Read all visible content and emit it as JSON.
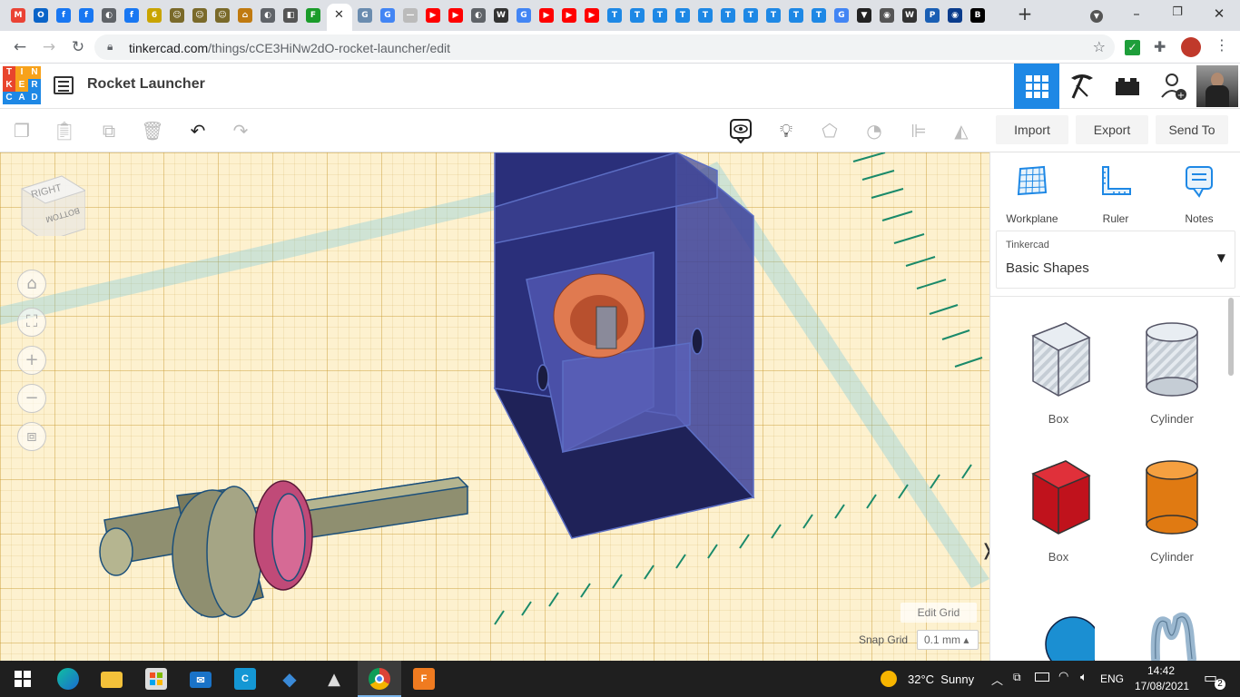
{
  "browser": {
    "tab_favicons": [
      {
        "icon": "gmail-icon",
        "color": "#ea4335",
        "glyph": "M"
      },
      {
        "icon": "outlook-icon",
        "color": "#0a64c8",
        "glyph": "O"
      },
      {
        "icon": "facebook-icon",
        "color": "#1877f2",
        "glyph": "f"
      },
      {
        "icon": "facebook-icon",
        "color": "#1877f2",
        "glyph": "f"
      },
      {
        "icon": "globe-icon",
        "color": "#5f6368",
        "glyph": "◐"
      },
      {
        "icon": "facebook-icon",
        "color": "#1877f2",
        "glyph": "f"
      },
      {
        "icon": "site-icon",
        "color": "#c9a400",
        "glyph": "6"
      },
      {
        "icon": "robot-icon",
        "color": "#7a6a2a",
        "glyph": "☺"
      },
      {
        "icon": "robot-icon",
        "color": "#7a6a2a",
        "glyph": "☺"
      },
      {
        "icon": "robot-icon",
        "color": "#7a6a2a",
        "glyph": "☺"
      },
      {
        "icon": "hat-icon",
        "color": "#c07a10",
        "glyph": "⌂"
      },
      {
        "icon": "globe-icon",
        "color": "#5f6368",
        "glyph": "◐"
      },
      {
        "icon": "shield-icon",
        "color": "#555",
        "glyph": "◧"
      },
      {
        "icon": "site-f-icon",
        "color": "#1a9c2a",
        "glyph": "F"
      }
    ],
    "more_tab_favicons": [
      {
        "icon": "docs-icon",
        "color": "#6a8caf",
        "glyph": "G"
      },
      {
        "icon": "google-icon",
        "color": "#4285f4",
        "glyph": "G"
      },
      {
        "icon": "bar-icon",
        "color": "#bbb",
        "glyph": "—"
      },
      {
        "icon": "youtube-icon",
        "color": "#ff0000",
        "glyph": "▶"
      },
      {
        "icon": "youtube-icon",
        "color": "#ff0000",
        "glyph": "▶"
      },
      {
        "icon": "globe-icon",
        "color": "#5f6368",
        "glyph": "◐"
      },
      {
        "icon": "wikipedia-icon",
        "color": "#333",
        "glyph": "W"
      },
      {
        "icon": "google-icon",
        "color": "#4285f4",
        "glyph": "G"
      },
      {
        "icon": "youtube-icon",
        "color": "#ff0000",
        "glyph": "▶"
      },
      {
        "icon": "youtube-icon",
        "color": "#ff0000",
        "glyph": "▶"
      },
      {
        "icon": "youtube-icon",
        "color": "#ff0000",
        "glyph": "▶"
      },
      {
        "icon": "tinkercad-t-icon",
        "color": "#1e88e5",
        "glyph": "T"
      },
      {
        "icon": "tinkercad-t-icon",
        "color": "#1e88e5",
        "glyph": "T"
      },
      {
        "icon": "tinkercad-t-icon",
        "color": "#1e88e5",
        "glyph": "T"
      },
      {
        "icon": "tinkercad-t-icon",
        "color": "#1e88e5",
        "glyph": "T"
      },
      {
        "icon": "tinkercad-t-icon",
        "color": "#1e88e5",
        "glyph": "T"
      },
      {
        "icon": "tinkercad-t-icon",
        "color": "#1e88e5",
        "glyph": "T"
      },
      {
        "icon": "tinkercad-t-icon",
        "color": "#1e88e5",
        "glyph": "T"
      },
      {
        "icon": "tinkercad-t-icon",
        "color": "#1e88e5",
        "glyph": "T"
      },
      {
        "icon": "tinkercad-t-icon",
        "color": "#1e88e5",
        "glyph": "T"
      },
      {
        "icon": "tinkercad-t-icon",
        "color": "#1e88e5",
        "glyph": "T"
      },
      {
        "icon": "google-icon",
        "color": "#4285f4",
        "glyph": "G"
      },
      {
        "icon": "shield-dark-icon",
        "color": "#222",
        "glyph": "▼"
      },
      {
        "icon": "chrome-icon",
        "color": "#555",
        "glyph": "◉"
      },
      {
        "icon": "wikipedia-icon",
        "color": "#333",
        "glyph": "W"
      },
      {
        "icon": "site-p-icon",
        "color": "#1a5fb4",
        "glyph": "P"
      },
      {
        "icon": "eye-icon",
        "color": "#0a3c8c",
        "glyph": "◉"
      },
      {
        "icon": "bbc-icon",
        "color": "#000",
        "glyph": "B"
      }
    ],
    "url_host": "tinkercad.com",
    "url_path": "/things/cCE3HiNw2dO-rocket-launcher/edit"
  },
  "app": {
    "logo_letters": [
      "T",
      "I",
      "N",
      "K",
      "E",
      "R",
      "C",
      "A",
      "D"
    ],
    "logo_colors": [
      "#e8452c",
      "#f7a21b",
      "#f7a21b",
      "#e8452c",
      "#f7a21b",
      "#1e88e5",
      "#1e88e5",
      "#1e88e5",
      "#1e88e5"
    ],
    "project_title": "Rocket Launcher",
    "accent": "#1e88e5"
  },
  "toolbar": {
    "import_label": "Import",
    "export_label": "Export",
    "send_to_label": "Send To"
  },
  "viewport": {
    "viewcube_face": "RIGHT",
    "viewcube_bottom_face": "BOTTOM",
    "edit_grid_label": "Edit Grid",
    "snap_grid_label": "Snap Grid",
    "snap_grid_value": "0.1 mm ▴"
  },
  "panel": {
    "tools": [
      {
        "label": "Workplane",
        "icon": "workplane-icon"
      },
      {
        "label": "Ruler",
        "icon": "ruler-icon"
      },
      {
        "label": "Notes",
        "icon": "notes-icon"
      }
    ],
    "library_small": "Tinkercad",
    "library_main": "Basic Shapes",
    "shapes": [
      {
        "label": "Box",
        "icon": "box-hole-icon",
        "color": "#b8c2cc"
      },
      {
        "label": "Cylinder",
        "icon": "cylinder-hole-icon",
        "color": "#b8c2cc"
      },
      {
        "label": "Box",
        "icon": "box-icon",
        "color": "#d3202a"
      },
      {
        "label": "Cylinder",
        "icon": "cylinder-icon",
        "color": "#e8811c"
      },
      {
        "label": "",
        "icon": "sphere-icon",
        "color": "#1b8fd2"
      },
      {
        "label": "",
        "icon": "scribble-icon",
        "color": "#9ab7cf"
      }
    ]
  },
  "taskbar": {
    "apps": [
      {
        "icon": "windows-start-icon"
      },
      {
        "icon": "edge-icon"
      },
      {
        "icon": "file-explorer-icon"
      },
      {
        "icon": "store-icon"
      },
      {
        "icon": "mail-icon"
      },
      {
        "icon": "c-app-icon"
      },
      {
        "icon": "diamond-app-icon"
      },
      {
        "icon": "triangle-app-icon"
      },
      {
        "icon": "chrome-icon"
      },
      {
        "icon": "fusion-icon"
      }
    ],
    "weather": "32°C  Sunny",
    "lang": "ENG",
    "time": "14:42",
    "date": "17/08/2021",
    "notifications": "2"
  }
}
